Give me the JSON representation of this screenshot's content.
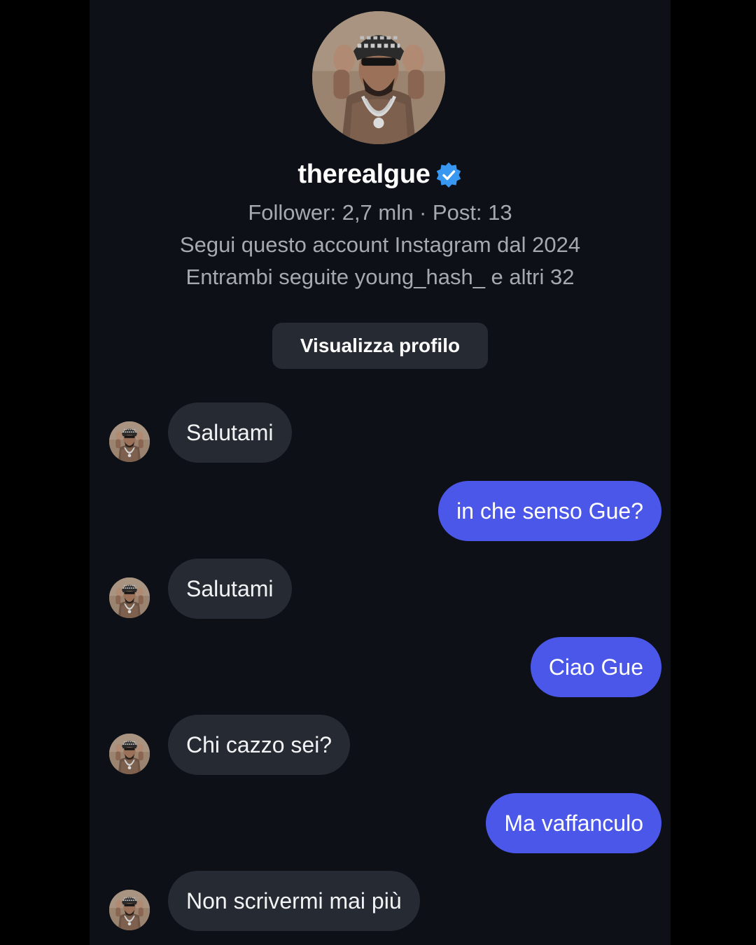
{
  "profile": {
    "username": "therealgue",
    "verified": true,
    "stats_line": "Follower: 2,7 mln · Post: 13",
    "since_line": "Segui questo account Instagram dal 2024",
    "mutual_line": "Entrambi seguite young_hash_ e altri 32",
    "view_profile_label": "Visualizza profilo"
  },
  "messages": [
    {
      "direction": "incoming",
      "text": "Salutami"
    },
    {
      "direction": "outgoing",
      "text": "in che senso Gue?"
    },
    {
      "direction": "incoming",
      "text": "Salutami"
    },
    {
      "direction": "outgoing",
      "text": "Ciao Gue"
    },
    {
      "direction": "incoming",
      "text": "Chi cazzo sei?"
    },
    {
      "direction": "outgoing",
      "text": "Ma vaffanculo"
    },
    {
      "direction": "incoming",
      "text": "Non scrivermi mai più"
    }
  ],
  "colors": {
    "background": "#0d1017",
    "incoming_bubble": "#262a33",
    "outgoing_bubble": "#4b57e8",
    "verified_badge": "#3897f0"
  }
}
